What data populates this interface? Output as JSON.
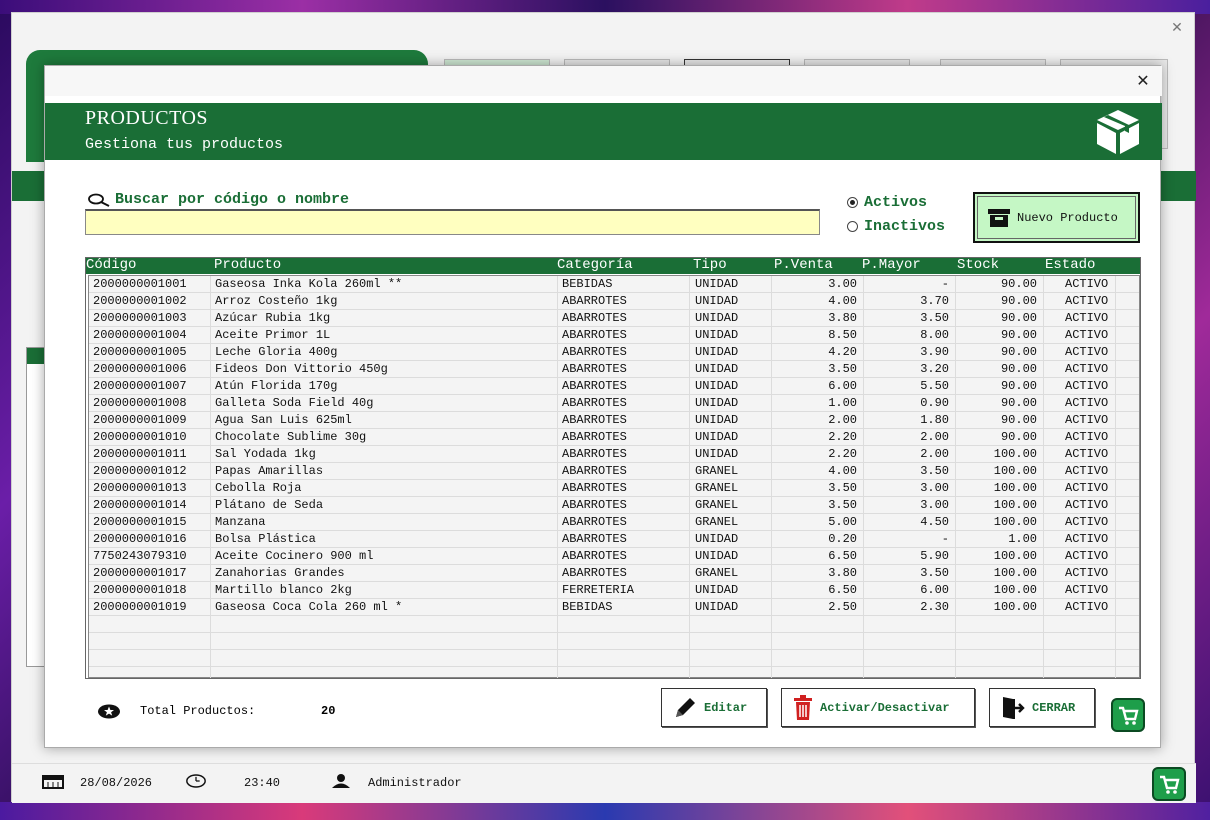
{
  "dialog": {
    "title": "PRODUCTOS",
    "subtitle": "Gestiona tus productos",
    "close_glyph": "✕"
  },
  "background_window": {
    "close_glyph": "✕"
  },
  "search": {
    "label": "Buscar por código o nombre",
    "value": "",
    "placeholder": ""
  },
  "filter": {
    "options": [
      {
        "label": "Activos",
        "selected": true
      },
      {
        "label": "Inactivos",
        "selected": false
      }
    ]
  },
  "buttons": {
    "new_product": "Nuevo Producto",
    "edit": "Editar",
    "toggle": "Activar/Desactivar",
    "close": "CERRAR"
  },
  "table": {
    "columns": [
      "Código",
      "Producto",
      "Categoría",
      "Tipo",
      "P.Venta",
      "P.Mayor",
      "Stock",
      "Estado"
    ],
    "rows": [
      [
        "2000000001001",
        "Gaseosa Inka Kola 260ml **",
        "BEBIDAS",
        "UNIDAD",
        "3.00",
        "-",
        "90.00",
        "ACTIVO"
      ],
      [
        "2000000001002",
        "Arroz Costeño 1kg",
        "ABARROTES",
        "UNIDAD",
        "4.00",
        "3.70",
        "90.00",
        "ACTIVO"
      ],
      [
        "2000000001003",
        "Azúcar Rubia 1kg",
        "ABARROTES",
        "UNIDAD",
        "3.80",
        "3.50",
        "90.00",
        "ACTIVO"
      ],
      [
        "2000000001004",
        "Aceite Primor 1L",
        "ABARROTES",
        "UNIDAD",
        "8.50",
        "8.00",
        "90.00",
        "ACTIVO"
      ],
      [
        "2000000001005",
        "Leche Gloria 400g",
        "ABARROTES",
        "UNIDAD",
        "4.20",
        "3.90",
        "90.00",
        "ACTIVO"
      ],
      [
        "2000000001006",
        "Fideos Don Vittorio 450g",
        "ABARROTES",
        "UNIDAD",
        "3.50",
        "3.20",
        "90.00",
        "ACTIVO"
      ],
      [
        "2000000001007",
        "Atún Florida 170g",
        "ABARROTES",
        "UNIDAD",
        "6.00",
        "5.50",
        "90.00",
        "ACTIVO"
      ],
      [
        "2000000001008",
        "Galleta Soda Field 40g",
        "ABARROTES",
        "UNIDAD",
        "1.00",
        "0.90",
        "90.00",
        "ACTIVO"
      ],
      [
        "2000000001009",
        "Agua San Luis 625ml",
        "ABARROTES",
        "UNIDAD",
        "2.00",
        "1.80",
        "90.00",
        "ACTIVO"
      ],
      [
        "2000000001010",
        "Chocolate Sublime 30g",
        "ABARROTES",
        "UNIDAD",
        "2.20",
        "2.00",
        "90.00",
        "ACTIVO"
      ],
      [
        "2000000001011",
        "Sal Yodada 1kg",
        "ABARROTES",
        "UNIDAD",
        "2.20",
        "2.00",
        "100.00",
        "ACTIVO"
      ],
      [
        "2000000001012",
        "Papas Amarillas",
        "ABARROTES",
        "GRANEL",
        "4.00",
        "3.50",
        "100.00",
        "ACTIVO"
      ],
      [
        "2000000001013",
        "Cebolla Roja",
        "ABARROTES",
        "GRANEL",
        "3.50",
        "3.00",
        "100.00",
        "ACTIVO"
      ],
      [
        "2000000001014",
        "Plátano de Seda",
        "ABARROTES",
        "GRANEL",
        "3.50",
        "3.00",
        "100.00",
        "ACTIVO"
      ],
      [
        "2000000001015",
        "Manzana",
        "ABARROTES",
        "GRANEL",
        "5.00",
        "4.50",
        "100.00",
        "ACTIVO"
      ],
      [
        "2000000001016",
        "Bolsa Plástica",
        "ABARROTES",
        "UNIDAD",
        "0.20",
        "-",
        "1.00",
        "ACTIVO"
      ],
      [
        "7750243079310",
        "Aceite Cocinero 900 ml",
        "ABARROTES",
        "UNIDAD",
        "6.50",
        "5.90",
        "100.00",
        "ACTIVO"
      ],
      [
        "2000000001017",
        "Zanahorias Grandes",
        "ABARROTES",
        "GRANEL",
        "3.80",
        "3.50",
        "100.00",
        "ACTIVO"
      ],
      [
        "2000000001018",
        "Martillo blanco 2kg",
        "FERRETERIA",
        "UNIDAD",
        "6.50",
        "6.00",
        "100.00",
        "ACTIVO"
      ],
      [
        "2000000001019",
        "Gaseosa Coca Cola 260 ml *",
        "BEBIDAS",
        "UNIDAD",
        "2.50",
        "2.30",
        "100.00",
        "ACTIVO"
      ]
    ]
  },
  "footer": {
    "total_label": "Total Productos:",
    "total_value": "20"
  },
  "statusbar": {
    "date": "28/08/2026",
    "time": "23:40",
    "user": "Administrador"
  },
  "colors": {
    "brand_green": "#1a6e36",
    "search_bg": "#ffffc0",
    "new_button_bg": "#c5f7c5",
    "delete_red": "#d02020"
  },
  "icons": [
    "search-icon",
    "box-icon",
    "archive-icon",
    "pencil-icon",
    "trash-icon",
    "exit-icon",
    "star-icon",
    "calendar-icon",
    "clock-icon",
    "user-icon",
    "cart-icon",
    "close-icon"
  ]
}
